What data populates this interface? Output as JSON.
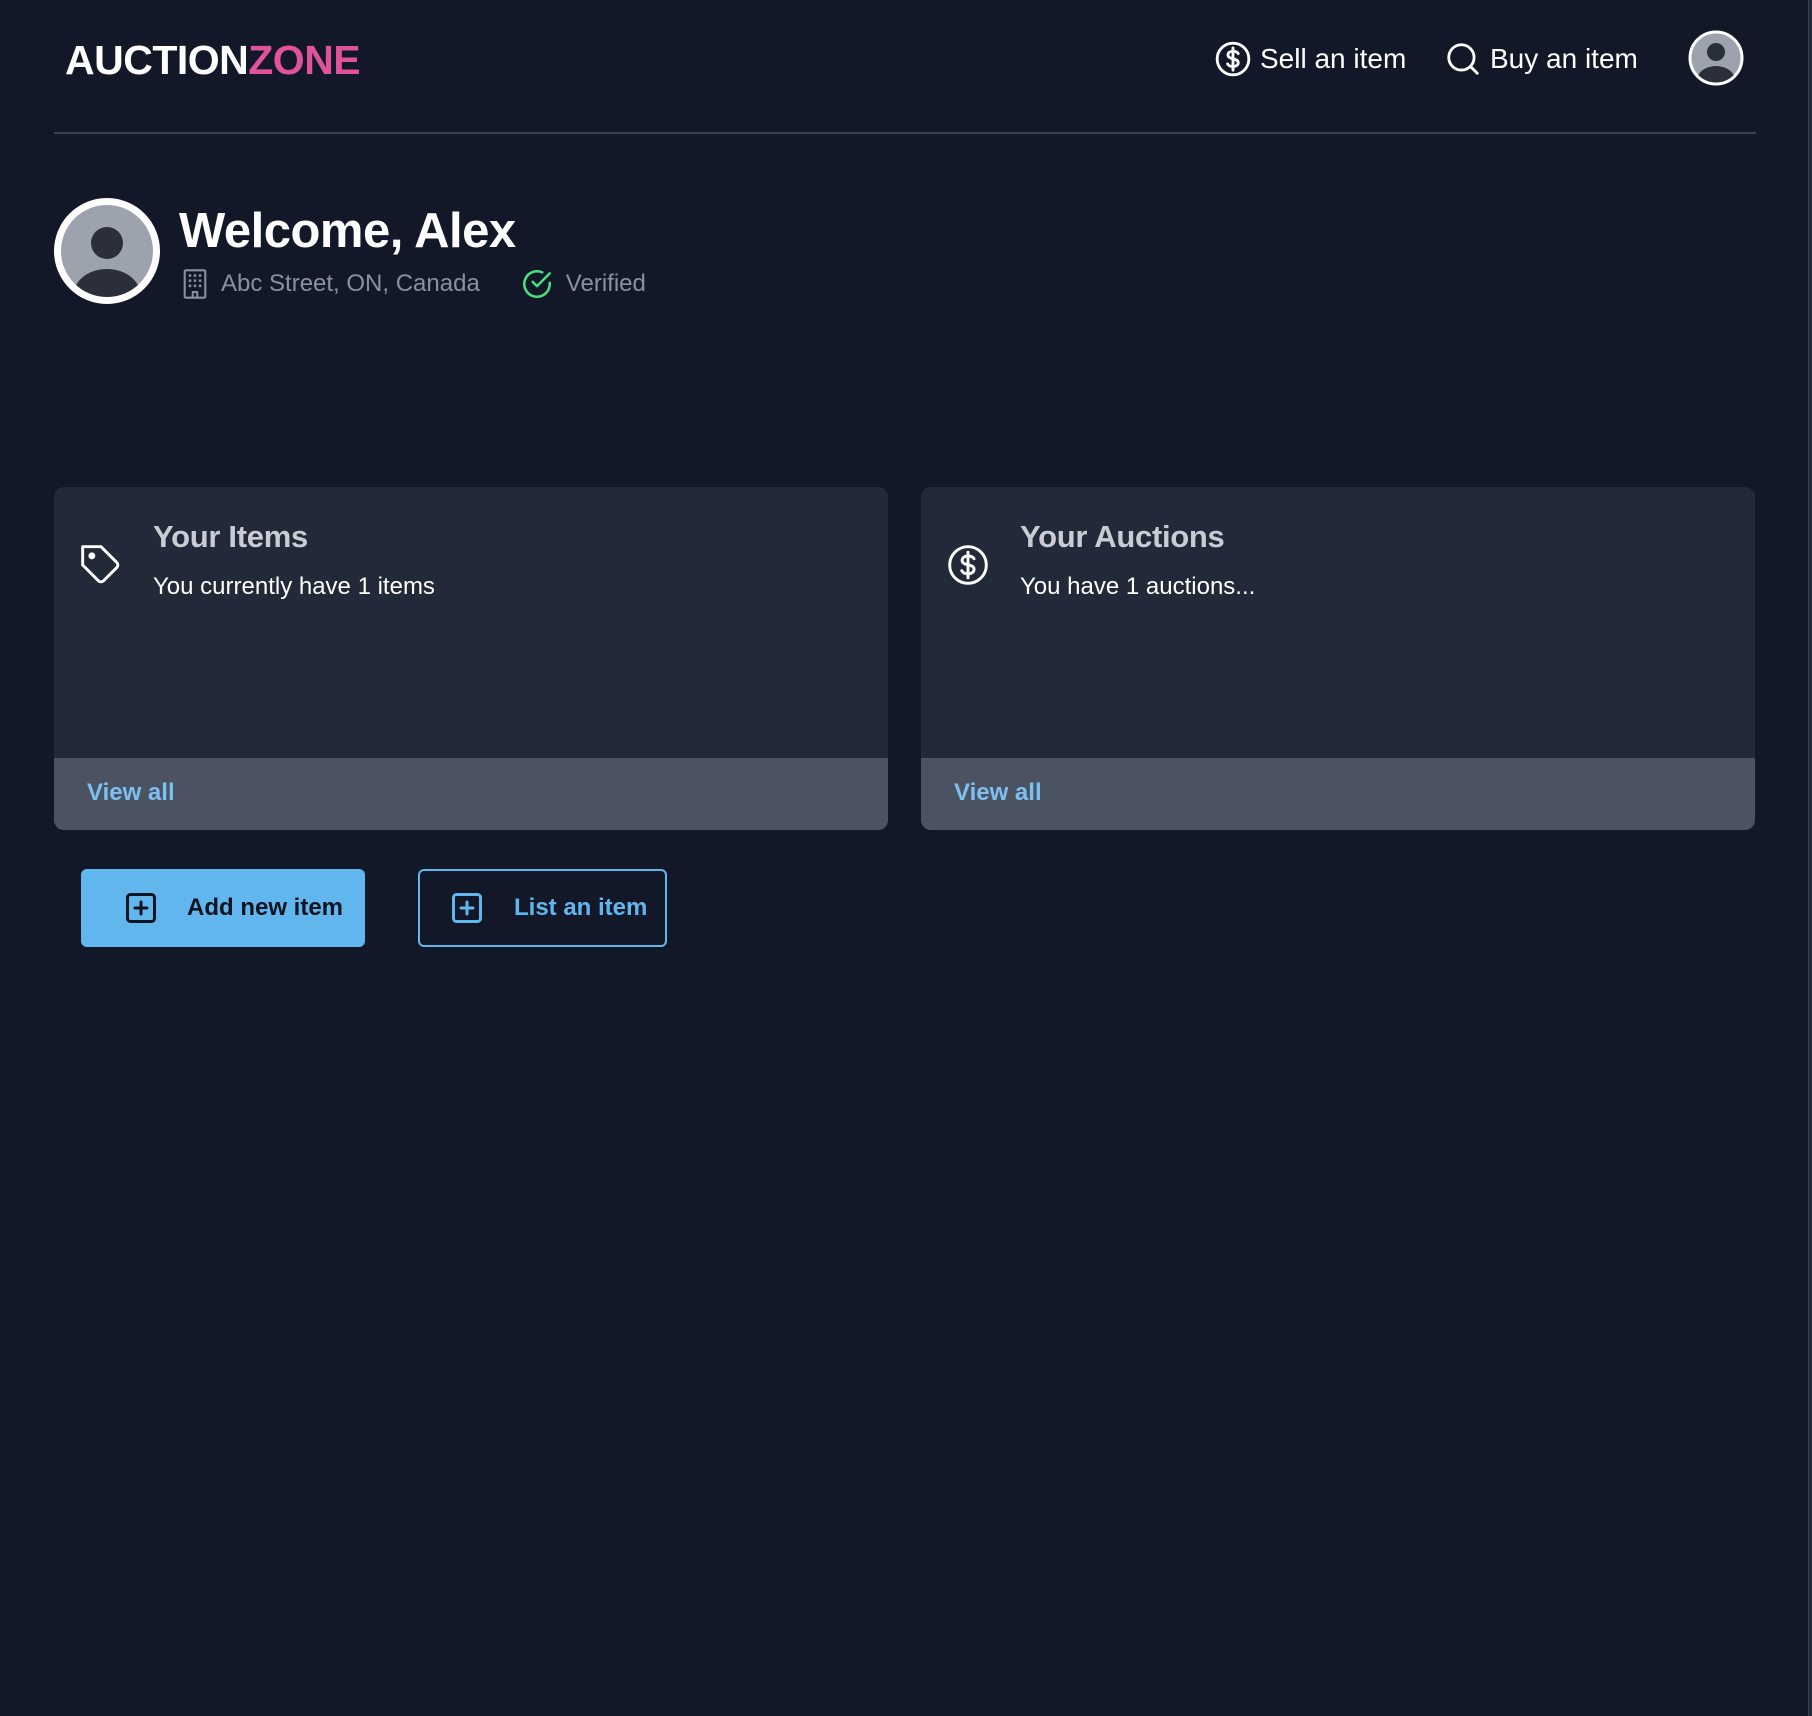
{
  "colors": {
    "background": "#121827",
    "card": "#222938",
    "card_footer": "#4b5363",
    "accent_blue": "#62b6ee",
    "link_blue": "#7cc0f0",
    "brand_pink": "#e0529c",
    "verified_green": "#4ade80",
    "muted_text": "#8a909c"
  },
  "header": {
    "logo_part1": "AUCTION",
    "logo_part2": "ZONE",
    "nav": [
      {
        "label": "Sell an item",
        "icon": "dollar-circle-icon"
      },
      {
        "label": "Buy an item",
        "icon": "search-icon"
      }
    ],
    "avatar_icon": "user-avatar-icon"
  },
  "welcome": {
    "title": "Welcome, Alex",
    "address": "Abc Street, ON, Canada",
    "address_icon": "building-icon",
    "status": "Verified",
    "status_icon": "check-circle-icon"
  },
  "cards": [
    {
      "title": "Your Items",
      "text": "You currently have 1 items",
      "icon": "tag-icon",
      "link": "View all"
    },
    {
      "title": "Your Auctions",
      "text": "You have 1 auctions...",
      "icon": "dollar-circle-icon",
      "link": "View all"
    }
  ],
  "actions": {
    "add_label": "Add new item",
    "add_icon": "plus-square-icon",
    "list_label": "List an item",
    "list_icon": "plus-square-icon"
  }
}
